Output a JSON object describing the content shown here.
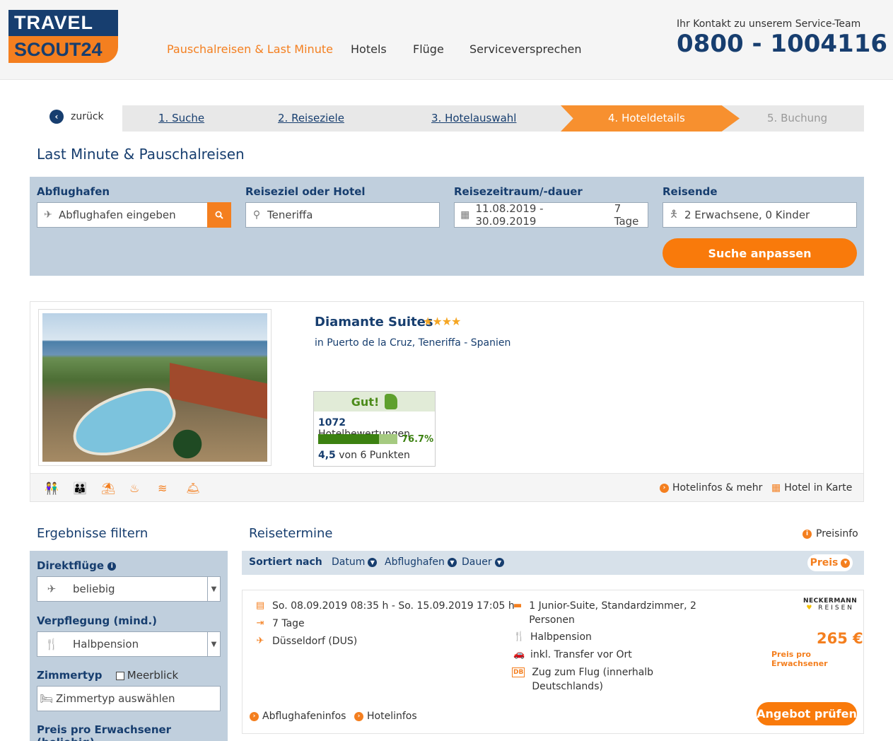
{
  "header": {
    "logo_top": "TRAVEL",
    "logo_bottom": "SCOUT24",
    "nav": [
      "Pauschalreisen & Last Minute",
      "Hotels",
      "Flüge",
      "Serviceversprechen"
    ],
    "contact_label": "Ihr Kontakt zu unserem Service-Team",
    "contact_phone": "0800 - 1004116"
  },
  "steps": {
    "back": "zurück",
    "items": [
      "1. Suche",
      "2. Reiseziele",
      "3. Hotelauswahl",
      "4. Hoteldetails",
      "5. Buchung"
    ],
    "active_index": 3
  },
  "page_title": "Last Minute & Pauschalreisen",
  "search": {
    "labels": [
      "Abflughafen",
      "Reiseziel oder Hotel",
      "Reisezeitraum/-dauer",
      "Reisende"
    ],
    "airport_placeholder": "Abflughafen eingeben",
    "destination_value": "Teneriffa",
    "date_value": "11.08.2019 - 30.09.2019",
    "duration_value": "7 Tage",
    "travellers_value": "2 Erwachsene, 0 Kinder",
    "submit": "Suche anpassen"
  },
  "hotel": {
    "name": "Diamante Suites",
    "stars": "★★★★",
    "location": "in Puerto de la Cruz, Teneriffa - Spanien",
    "rating_word": "Gut!",
    "review_count": "1072",
    "review_label": "Hotelbewertungen",
    "recommend_pct": "76.7%",
    "recommend_fraction": 0.767,
    "points_value": "4,5",
    "points_label": "von 6 Punkten",
    "links": [
      "Hotelinfos & mehr",
      "Hotel in Karte"
    ]
  },
  "filter": {
    "title": "Ergebnisse filtern",
    "direct_label": "Direktflüge",
    "direct_value": "beliebig",
    "board_label": "Verpflegung (mind.)",
    "board_value": "Halbpension",
    "room_label": "Zimmertyp",
    "seaview_label": "Meerblick",
    "room_placeholder": "Zimmertyp auswählen",
    "price_label": "Preis pro Erwachsener (beliebig)"
  },
  "results": {
    "title": "Reisetermine",
    "preisinfo": "Preisinfo",
    "sort_label": "Sortiert nach",
    "sort_items": [
      "Datum",
      "Abflughafen",
      "Dauer"
    ],
    "sort_price": "Preis",
    "offer": {
      "dates": "So. 08.09.2019 08:35 h - So. 15.09.2019 17:05 h",
      "duration": "7 Tage",
      "airport": "Düsseldorf (DUS)",
      "room": "1 Junior-Suite, Standardzimmer, 2 Personen",
      "board": "Halbpension",
      "transfer": "inkl. Transfer vor Ort",
      "db_badge": "DB",
      "train": "Zug zum Flug (innerhalb Deutschlands)",
      "brand_top": "NECKERMANN",
      "brand_bottom": "REISEN",
      "price": "265 €",
      "price_note": "Preis pro Erwachsener",
      "cta": "Angebot prüfen",
      "links": [
        "Abflughafeninfos",
        "Hotelinfos"
      ]
    }
  }
}
